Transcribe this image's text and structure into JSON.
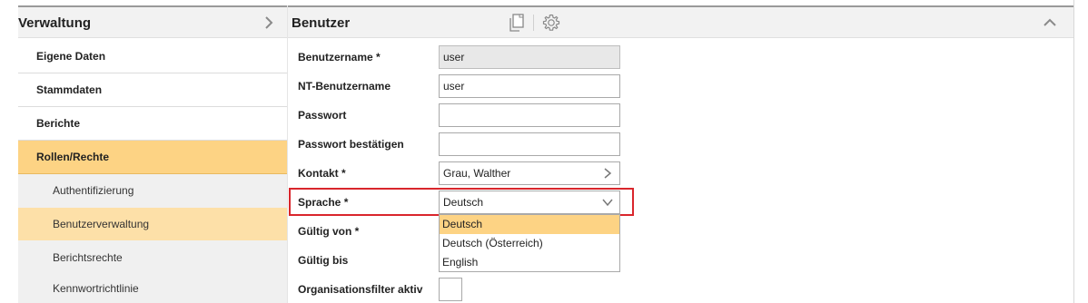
{
  "sidebar": {
    "title": "Verwaltung",
    "items": [
      {
        "label": "Eigene Daten"
      },
      {
        "label": "Stammdaten"
      },
      {
        "label": "Berichte"
      },
      {
        "label": "Rollen/Rechte"
      },
      {
        "label": "Authentifizierung"
      },
      {
        "label": "Benutzerverwaltung"
      },
      {
        "label": "Berichtsrechte"
      },
      {
        "label": "Kennwortrichtlinie"
      }
    ]
  },
  "main": {
    "title": "Benutzer",
    "form": {
      "benutzername": {
        "label": "Benutzername *",
        "value": "user"
      },
      "nt_benutzername": {
        "label": "NT-Benutzername",
        "value": "user"
      },
      "passwort": {
        "label": "Passwort",
        "value": ""
      },
      "passwort_bestaetigen": {
        "label": "Passwort bestätigen",
        "value": ""
      },
      "kontakt": {
        "label": "Kontakt *",
        "value": "Grau, Walther"
      },
      "sprache": {
        "label": "Sprache *",
        "value": "Deutsch",
        "options": [
          "Deutsch",
          "Deutsch (Österreich)",
          "English"
        ]
      },
      "gueltig_von": {
        "label": "Gültig von *"
      },
      "gueltig_bis": {
        "label": "Gültig bis"
      },
      "organisationsfilter": {
        "label": "Organisationsfilter aktiv"
      }
    }
  },
  "colors": {
    "accent_active": "#fdd384",
    "accent_sub_active": "#fde0a8",
    "highlight_border": "#d9262c"
  },
  "icons": {
    "copy": "copy-icon",
    "settings": "gear-icon",
    "collapse": "chevron-up-icon",
    "sidebar_collapse": "chevron-right-icon"
  }
}
